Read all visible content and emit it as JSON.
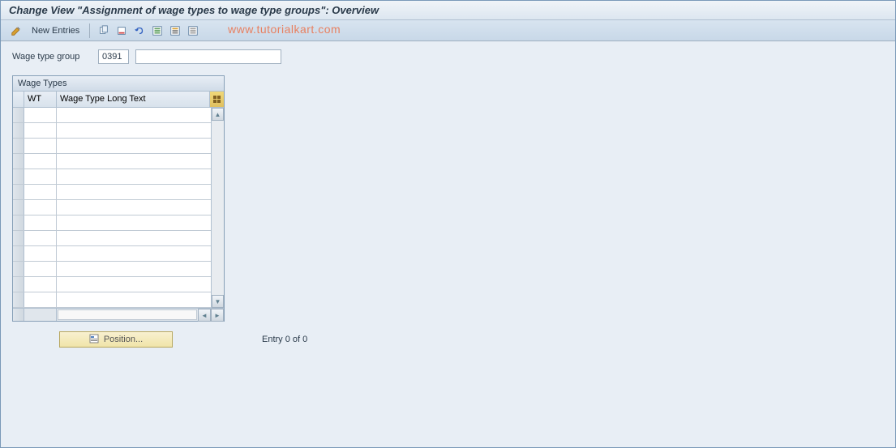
{
  "title": "Change View \"Assignment of wage types to wage type groups\": Overview",
  "toolbar": {
    "new_entries_label": "New Entries"
  },
  "watermark": "www.tutorialkart.com",
  "fields": {
    "wage_type_group_label": "Wage type group",
    "wage_type_group_value": "0391",
    "wage_type_group_desc": ""
  },
  "table": {
    "title": "Wage Types",
    "columns": {
      "wt": "WT",
      "longtext": "Wage Type Long Text"
    },
    "rows": [
      {
        "wt": "",
        "longtext": ""
      },
      {
        "wt": "",
        "longtext": ""
      },
      {
        "wt": "",
        "longtext": ""
      },
      {
        "wt": "",
        "longtext": ""
      },
      {
        "wt": "",
        "longtext": ""
      },
      {
        "wt": "",
        "longtext": ""
      },
      {
        "wt": "",
        "longtext": ""
      },
      {
        "wt": "",
        "longtext": ""
      },
      {
        "wt": "",
        "longtext": ""
      },
      {
        "wt": "",
        "longtext": ""
      },
      {
        "wt": "",
        "longtext": ""
      },
      {
        "wt": "",
        "longtext": ""
      },
      {
        "wt": "",
        "longtext": ""
      }
    ]
  },
  "footer": {
    "position_button": "Position...",
    "entry_text": "Entry 0 of 0"
  }
}
